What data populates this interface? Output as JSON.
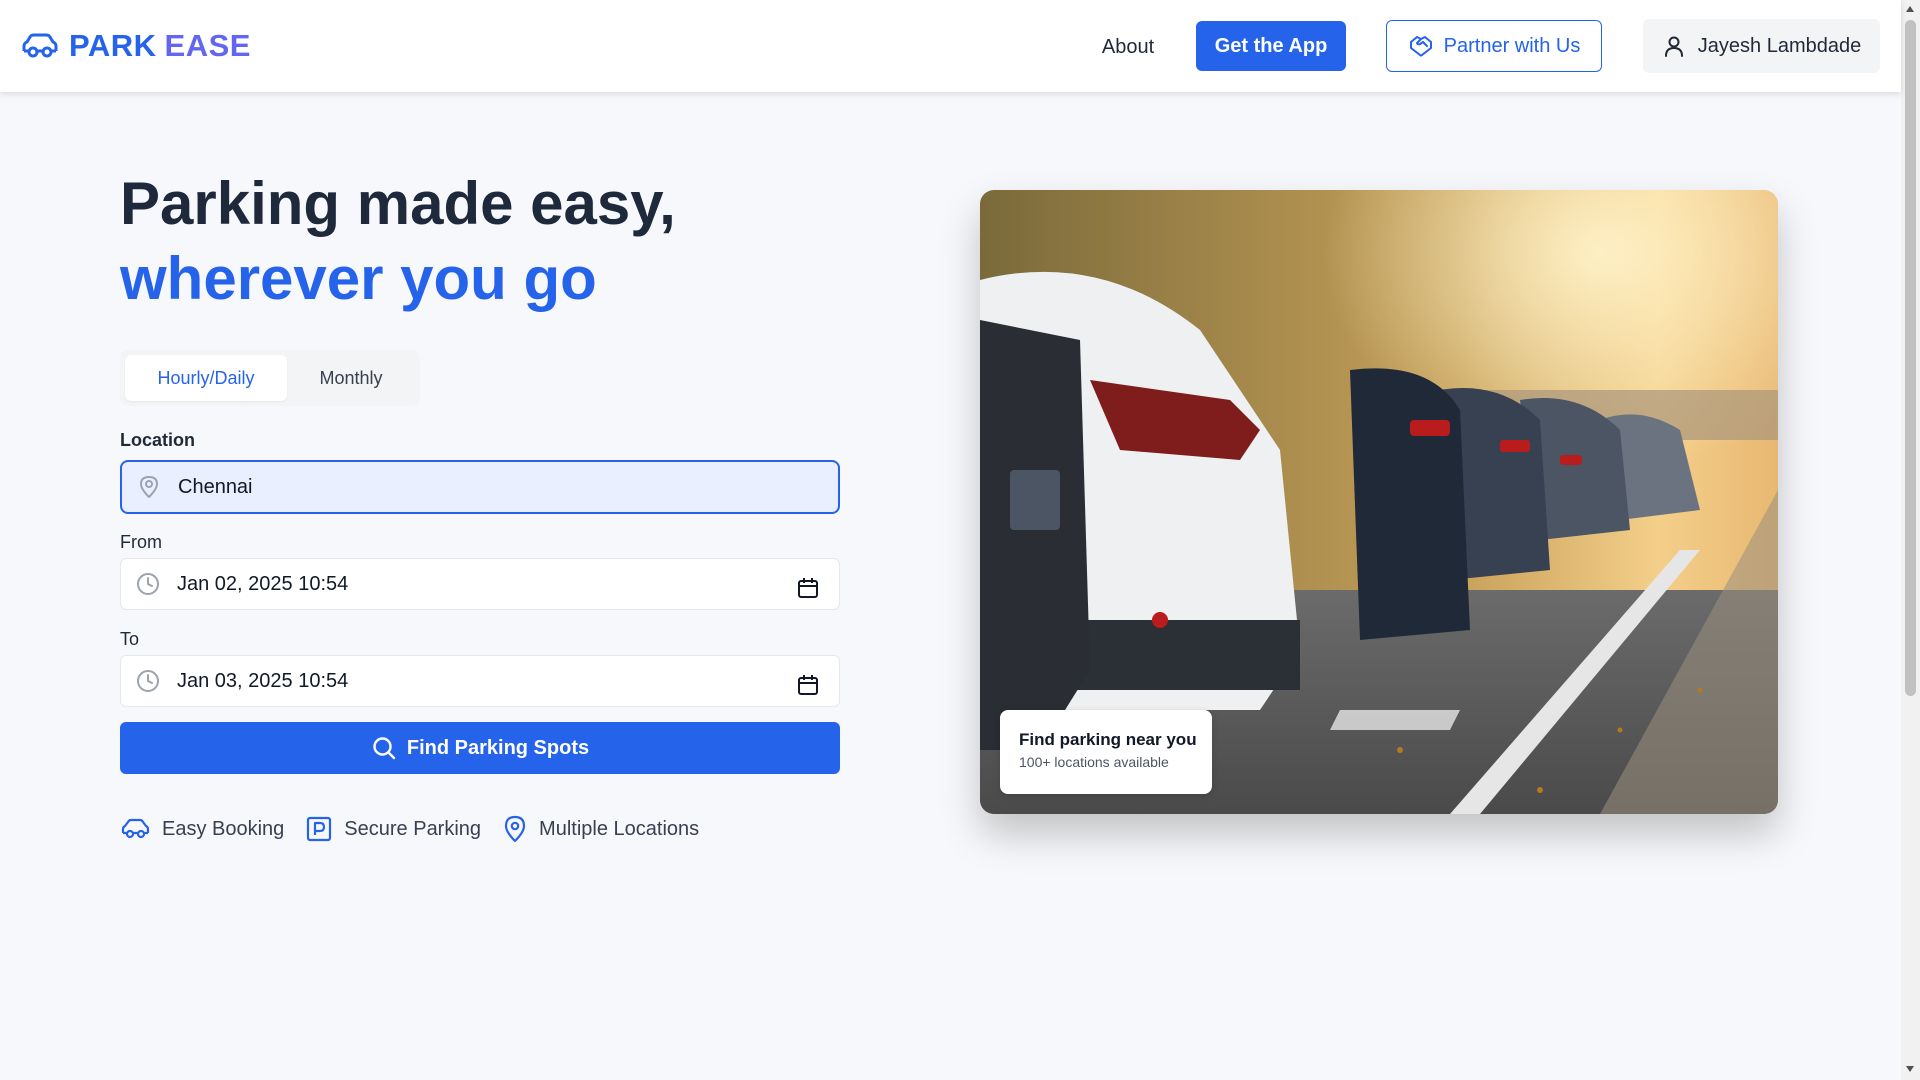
{
  "header": {
    "brand_part1": "PARK",
    "brand_part2": "EASE",
    "about_label": "About",
    "get_app_label": "Get the App",
    "partner_label": "Partner with Us",
    "user_name": "Jayesh Lambdade",
    "icons": [
      "car-icon",
      "handshake-icon",
      "user-icon"
    ]
  },
  "hero": {
    "title_line1": "Parking made easy,",
    "title_line2": "wherever you go"
  },
  "booking": {
    "tabs": [
      {
        "label": "Hourly/Daily",
        "active": true
      },
      {
        "label": "Monthly",
        "active": false
      }
    ],
    "location_label": "Location",
    "location_value": "Chennai",
    "from_label": "From",
    "from_value": "Jan 02, 2025 10:54",
    "to_label": "To",
    "to_value": "Jan 03, 2025 10:54",
    "find_label": "Find Parking Spots"
  },
  "features": [
    {
      "label": "Easy Booking",
      "icon": "car-icon"
    },
    {
      "label": "Secure Parking",
      "icon": "parking-sign-icon"
    },
    {
      "label": "Multiple Locations",
      "icon": "map-pin-icon"
    }
  ],
  "image_card": {
    "overlay_title": "Find parking near you",
    "overlay_subtitle": "100+ locations available"
  },
  "colors": {
    "primary": "#2563eb",
    "brand_secondary": "#6366f1",
    "heading": "#1e293b",
    "background": "#f7f8fb"
  }
}
